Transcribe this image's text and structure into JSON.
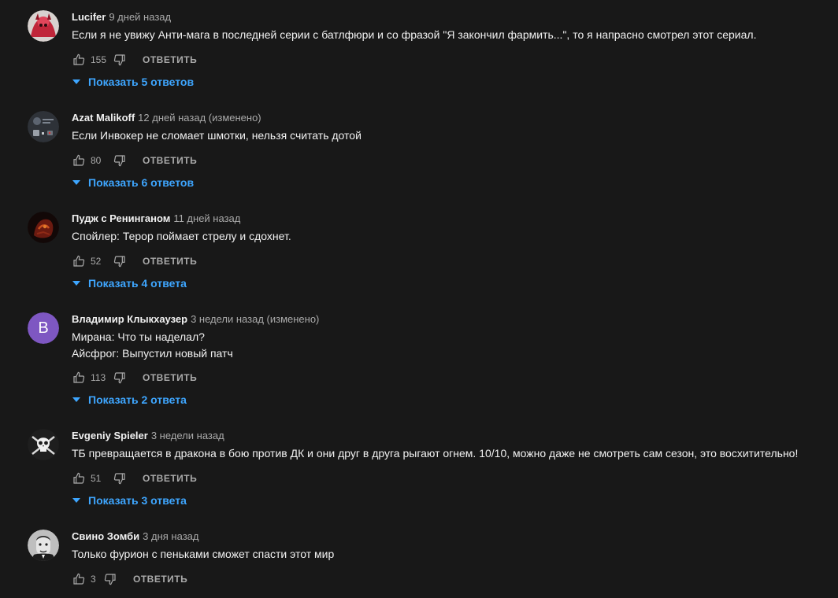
{
  "comments": [
    {
      "author": "Lucifer",
      "time": "9 дней назад",
      "lines": [
        "Если я не  увижу Анти-мага в последней серии с батлфюри и со фразой \"Я закончил фармить...\", то я напрасно смотрел этот сериал."
      ],
      "likes": "155",
      "reply_label": "ОТВЕТИТЬ",
      "replies_label": "Показать 5 ответов",
      "avatar": "lucifer-avatar"
    },
    {
      "author": "Azat Malikoff",
      "time": "12 дней назад (изменено)",
      "lines": [
        "Если Инвокер не сломает шмотки, нельзя считать дотой"
      ],
      "likes": "80",
      "reply_label": "ОТВЕТИТЬ",
      "replies_label": "Показать 6 ответов",
      "avatar": "azat-avatar"
    },
    {
      "author": "Пудж с Ренинганом",
      "time": "11 дней назад",
      "lines": [
        "Спойлер: Терор поймает стрелу и сдохнет."
      ],
      "likes": "52",
      "reply_label": "ОТВЕТИТЬ",
      "replies_label": "Показать 4 ответа",
      "avatar": "pudge-avatar"
    },
    {
      "author": "Владимир Клыкхаузер",
      "time": "3 недели назад (изменено)",
      "lines": [
        "Мирана: Что ты наделал?",
        "Айсфрог: Выпустил новый патч"
      ],
      "likes": "113",
      "reply_label": "ОТВЕТИТЬ",
      "replies_label": "Показать 2 ответа",
      "avatar_letter": "В",
      "avatar_color": "#7e57c2"
    },
    {
      "author": "Evgeniy Spieler",
      "time": "3 недели назад",
      "lines": [
        "ТБ превращается в дракона в бою против ДК и они друг в друга рыгают огнем. 10/10, можно даже не смотреть сам сезон, это восхитительно!"
      ],
      "likes": "51",
      "reply_label": "ОТВЕТИТЬ",
      "replies_label": "Показать 3 ответа",
      "avatar": "skull-avatar"
    },
    {
      "author": "Свино Зомби",
      "time": "3 дня назад",
      "lines": [
        "Только фурион с пеньками сможет спасти этот мир"
      ],
      "likes": "3",
      "reply_label": "ОТВЕТИТЬ",
      "avatar": "zombie-avatar"
    }
  ],
  "colors": {
    "background": "#181818",
    "text": "#f1f1f1",
    "muted": "#aaaaaa",
    "link": "#3ea6ff"
  }
}
